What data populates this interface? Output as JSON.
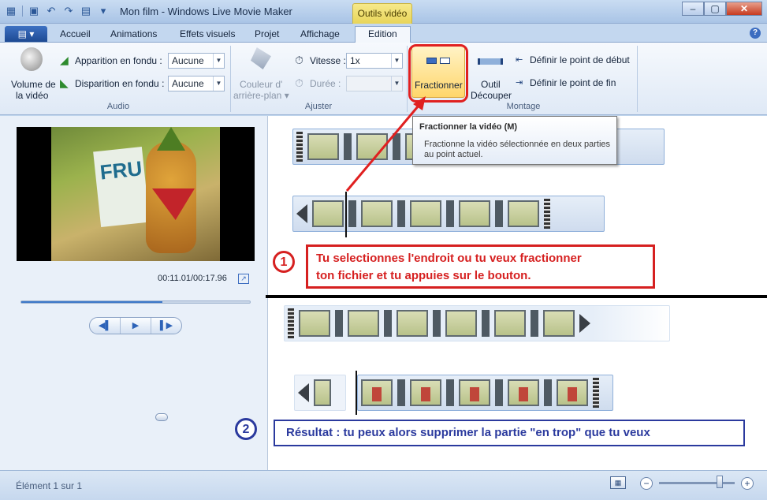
{
  "window": {
    "title": "Mon film - Windows Live Movie Maker",
    "context_tab_label": "Outils vidéo",
    "min_label": "‒",
    "max_label": "▢",
    "close_label": "✕"
  },
  "ribbon": {
    "file_button_label": "▤ ▾",
    "help_label": "?",
    "tabs": [
      {
        "label": "Accueil"
      },
      {
        "label": "Animations"
      },
      {
        "label": "Effets visuels"
      },
      {
        "label": "Projet"
      },
      {
        "label": "Affichage"
      },
      {
        "label": "Edition"
      }
    ],
    "audio": {
      "volume_label_1": "Volume de",
      "volume_label_2": "la vidéo",
      "fade_in_label": "Apparition en fondu :",
      "fade_in_value": "Aucune",
      "fade_out_label": "Disparition en fondu :",
      "fade_out_value": "Aucune",
      "group_label": "Audio"
    },
    "adjust": {
      "bg_color_label_1": "Couleur d'",
      "bg_color_label_2": "arrière-plan ▾",
      "speed_label": "Vitesse :",
      "speed_value": "1x",
      "duration_label": "Durée :",
      "group_label": "Ajuster"
    },
    "edit": {
      "split_label": "Fractionner",
      "trim_label_1": "Outil",
      "trim_label_2": "Découper",
      "set_start_label": "Définir le point de début",
      "set_end_label": "Définir le point de fin",
      "group_label": "Montage"
    }
  },
  "tooltip": {
    "title": "Fractionner la vidéo (M)",
    "description": "Fractionne la vidéo sélectionnée en deux parties au point actuel."
  },
  "preview": {
    "sign_text": "FRU",
    "timecode": "00:11.01/00:17.96",
    "seek_fraction": 0.613,
    "prev_frame": "◀▌",
    "play": "▶",
    "next_frame": "▌▶"
  },
  "annotations": {
    "step1_number": "1",
    "step1_text_line1": "Tu selectionnes l'endroit ou tu veux fractionner",
    "step1_text_line2": "ton fichier et tu appuies sur le bouton.",
    "step2_number": "2",
    "step2_text": "Résultat : tu peux alors supprimer la partie \"en trop\" que tu veux",
    "arrow_color": "#e02020"
  },
  "status": {
    "item_count": "Élément 1 sur 1",
    "zoom_minus": "−",
    "zoom_plus": "+",
    "zoom_fraction": 0.8
  }
}
